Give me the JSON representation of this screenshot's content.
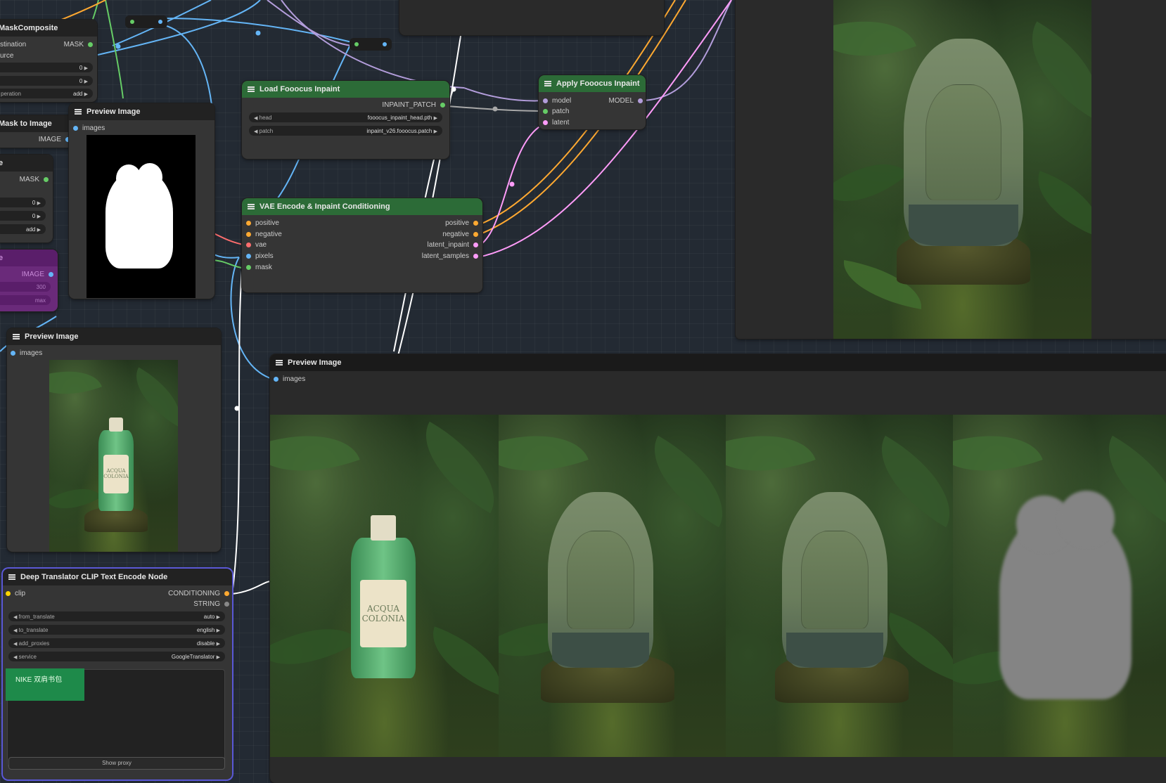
{
  "nodes": {
    "mask_composite": {
      "title": "MaskComposite",
      "inputs": [
        "stination",
        "urce"
      ],
      "output": "MASK",
      "widgets": [
        {
          "label": "",
          "value": "0"
        },
        {
          "label": "",
          "value": "0"
        },
        {
          "label": "peration",
          "value": "add"
        }
      ]
    },
    "mask_to_image": {
      "title": "Mask to Image",
      "output": "IMAGE"
    },
    "node_e": {
      "title": "e",
      "output": "MASK",
      "widgets": [
        {
          "label": "",
          "value": "0"
        },
        {
          "label": "",
          "value": "0"
        },
        {
          "label": "",
          "value": "add"
        }
      ]
    },
    "purple_node": {
      "title": "e",
      "output": "IMAGE",
      "w1": "300",
      "w2": "max"
    },
    "preview_mask": {
      "title": "Preview Image",
      "input": "images"
    },
    "load_fooocus": {
      "title": "Load Fooocus Inpaint",
      "output": "INPAINT_PATCH",
      "widgets": [
        {
          "label": "head",
          "value": "fooocus_inpaint_head.pth"
        },
        {
          "label": "patch",
          "value": "inpaint_v26.fooocus.patch"
        }
      ]
    },
    "apply_fooocus": {
      "title": "Apply Fooocus Inpaint",
      "inputs": [
        "model",
        "patch",
        "latent"
      ],
      "output": "MODEL"
    },
    "vae_encode": {
      "title": "VAE Encode & Inpaint Conditioning",
      "inputs": [
        "positive",
        "negative",
        "vae",
        "pixels",
        "mask"
      ],
      "outputs": [
        "positive",
        "negative",
        "latent_inpaint",
        "latent_samples"
      ]
    },
    "preview_bottle": {
      "title": "Preview Image",
      "input": "images"
    },
    "deep_translator": {
      "title": "Deep Translator CLIP Text Encode Node",
      "input": "clip",
      "outputs": [
        "CONDITIONING",
        "STRING"
      ],
      "widgets": [
        {
          "label": "from_translate",
          "value": "auto"
        },
        {
          "label": "to_translate",
          "value": "english"
        },
        {
          "label": "add_proxies",
          "value": "disable"
        },
        {
          "label": "service",
          "value": "GoogleTranslator"
        }
      ],
      "text": "NIKE 双肩书包",
      "button": "Show proxy"
    },
    "preview_big": {
      "title": "Preview Image",
      "input": "images"
    }
  },
  "bottle_label": {
    "line1": "ACQUA",
    "line2": "COLONIA"
  },
  "colors": {
    "green_title": "#2c6b37",
    "port_mask": "#66cc66",
    "port_image": "#64b5f6",
    "port_cond": "#ffa931",
    "port_vae": "#ff6e6e",
    "port_latent": "#ff9cf9",
    "port_model": "#b39ddb",
    "port_patch": "#a8a8a8",
    "port_clip": "#ffd500"
  }
}
